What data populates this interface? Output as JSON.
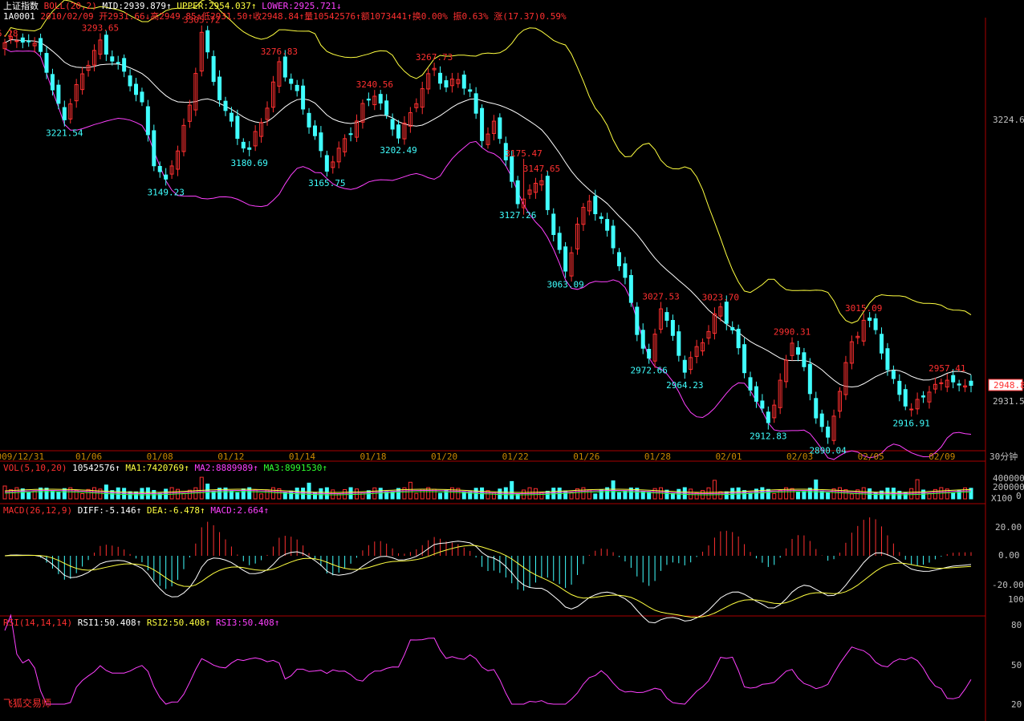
{
  "header": {
    "index_name": "上证指数",
    "boll_label": "BOLL(20,2)",
    "mid": "MID:2939.879↑",
    "upper": "UPPER:2954.037↑",
    "lower": "LOWER:2925.721↓",
    "code": "1A0001",
    "quote": "2010/02/09 开2931.66↓高2949.85↑低2931.50↑收2948.84↑量10542576↑额1073441↑换0.00% 振0.63% 涨(17.37)0.59%"
  },
  "volume_header": {
    "label": "VOL(5,10,20)",
    "value": "10542576↑",
    "ma1": "MA1:7420769↑",
    "ma2": "MA2:8889989↑",
    "ma3": "MA3:8991530↑"
  },
  "macd_header": {
    "label": "MACD(26,12,9)",
    "diff": "DIFF:-5.146↑",
    "dea": "DEA:-6.478↑",
    "macd": "MACD:2.664↑"
  },
  "rsi_header": {
    "label": "RSI(14,14,14)",
    "rsi1": "RSI1:50.408↑",
    "rsi2": "RSI2:50.408↑",
    "rsi3": "RSI3:50.408↑"
  },
  "watermark": "飞狐交易师",
  "colors": {
    "up": "#ff3030",
    "down": "#40ffff",
    "upper": "#ffff40",
    "mid": "#ffffff",
    "lower": "#ff40ff",
    "macd_up": "#ff3030",
    "macd_down": "#40ffff",
    "rsi": "#ff40ff",
    "axis": "#aa0000"
  },
  "chart_data": [
    {
      "type": "candlestick",
      "title": "上证指数 BOLL(20,2) 30分钟",
      "period_label": "30分钟",
      "x_ticks": [
        "2009/12/31",
        "01/06",
        "01/08",
        "01/12",
        "01/14",
        "01/18",
        "01/20",
        "01/22",
        "01/26",
        "01/28",
        "02/01",
        "02/03",
        "02/05",
        "02/09"
      ],
      "y_tick_labels": [
        "3224.6",
        "2931.5"
      ],
      "last_price_label": "2948.8",
      "ylim": [
        2880,
        3320
      ],
      "close_path": [
        [
          0,
          3290
        ],
        [
          3,
          3300
        ],
        [
          6,
          3285
        ],
        [
          8,
          3240
        ],
        [
          10,
          3221.5
        ],
        [
          13,
          3260
        ],
        [
          16,
          3293
        ],
        [
          18,
          3280
        ],
        [
          20,
          3260
        ],
        [
          23,
          3230
        ],
        [
          25,
          3175
        ],
        [
          27,
          3149.2
        ],
        [
          29,
          3185
        ],
        [
          31,
          3230
        ],
        [
          33,
          3305.7
        ],
        [
          35,
          3250
        ],
        [
          37,
          3225
        ],
        [
          39,
          3200
        ],
        [
          41,
          3180.7
        ],
        [
          44,
          3230
        ],
        [
          46,
          3275
        ],
        [
          48,
          3250
        ],
        [
          50,
          3225
        ],
        [
          52,
          3200
        ],
        [
          54,
          3165.8
        ],
        [
          56,
          3180
        ],
        [
          58,
          3205
        ],
        [
          60,
          3230
        ],
        [
          62,
          3240.6
        ],
        [
          64,
          3215
        ],
        [
          66,
          3202.5
        ],
        [
          68,
          3220
        ],
        [
          70,
          3245
        ],
        [
          72,
          3267.7
        ],
        [
          74,
          3250
        ],
        [
          76,
          3255
        ],
        [
          78,
          3240
        ],
        [
          80,
          3200
        ],
        [
          82,
          3210
        ],
        [
          84,
          3175.4
        ],
        [
          86,
          3127.3
        ],
        [
          88,
          3150
        ],
        [
          90,
          3147.7
        ],
        [
          92,
          3100
        ],
        [
          94,
          3063.1
        ],
        [
          96,
          3110
        ],
        [
          98,
          3130
        ],
        [
          100,
          3115
        ],
        [
          102,
          3090
        ],
        [
          104,
          3050
        ],
        [
          106,
          3000
        ],
        [
          108,
          2972.7
        ],
        [
          110,
          3027.5
        ],
        [
          112,
          2990
        ],
        [
          114,
          2964.2
        ],
        [
          116,
          2985
        ],
        [
          118,
          3000
        ],
        [
          120,
          3023.7
        ],
        [
          122,
          3005
        ],
        [
          124,
          2960
        ],
        [
          126,
          2925
        ],
        [
          128,
          2912.9
        ],
        [
          130,
          2950
        ],
        [
          132,
          2990.3
        ],
        [
          134,
          2960
        ],
        [
          136,
          2920
        ],
        [
          138,
          2890
        ],
        [
          140,
          2940
        ],
        [
          142,
          2990
        ],
        [
          144,
          3015.1
        ],
        [
          146,
          3000
        ],
        [
          148,
          2960
        ],
        [
          150,
          2942
        ],
        [
          152,
          2918.9
        ],
        [
          154,
          2935
        ],
        [
          156,
          2945
        ],
        [
          158,
          2957.4
        ],
        [
          160,
          2940
        ],
        [
          162,
          2948.8
        ]
      ],
      "high_labels": [
        {
          "text": "95.28",
          "i": 0
        },
        {
          "text": "3293.65",
          "i": 16
        },
        {
          "text": "3305.72",
          "i": 33
        },
        {
          "text": "3276.83",
          "i": 46
        },
        {
          "text": "3240.56",
          "i": 62
        },
        {
          "text": "3267.73",
          "i": 72
        },
        {
          "text": "3175.47",
          "i": 87
        },
        {
          "text": "3147.65",
          "i": 90
        },
        {
          "text": "3027.53",
          "i": 110
        },
        {
          "text": "3023.70",
          "i": 120
        },
        {
          "text": "2990.31",
          "i": 132
        },
        {
          "text": "3015.09",
          "i": 144
        },
        {
          "text": "2957.41",
          "i": 158
        }
      ],
      "low_labels": [
        {
          "text": "3221.54",
          "i": 10
        },
        {
          "text": "3149.23",
          "i": 27
        },
        {
          "text": "3180.69",
          "i": 41
        },
        {
          "text": "3165.75",
          "i": 54
        },
        {
          "text": "3202.49",
          "i": 66
        },
        {
          "text": "3127.26",
          "i": 86
        },
        {
          "text": "3063.09",
          "i": 94
        },
        {
          "text": "2972.66",
          "i": 108
        },
        {
          "text": "2964.23",
          "i": 114
        },
        {
          "text": "2912.83",
          "i": 128
        },
        {
          "text": "2890.04",
          "i": 138
        },
        {
          "text": "2916.91",
          "i": 152
        }
      ],
      "boll_mid": "MID:2939.879",
      "boll_upper": "UPPER:2954.037",
      "boll_lower": "LOWER:2925.721"
    },
    {
      "type": "bar",
      "title": "VOL(5,10,20)",
      "y_tick_labels": [
        "400000",
        "200000",
        "0"
      ],
      "unit_label": "X100"
    },
    {
      "type": "bar",
      "title": "MACD(26,12,9)",
      "y_tick_labels": [
        "20.00",
        "0.00",
        "-20.00"
      ],
      "ylim": [
        -30,
        30
      ]
    },
    {
      "type": "line",
      "title": "RSI(14,14,14)",
      "y_tick_labels": [
        "100",
        "80",
        "50",
        "20"
      ],
      "ylim": [
        15,
        105
      ]
    }
  ]
}
